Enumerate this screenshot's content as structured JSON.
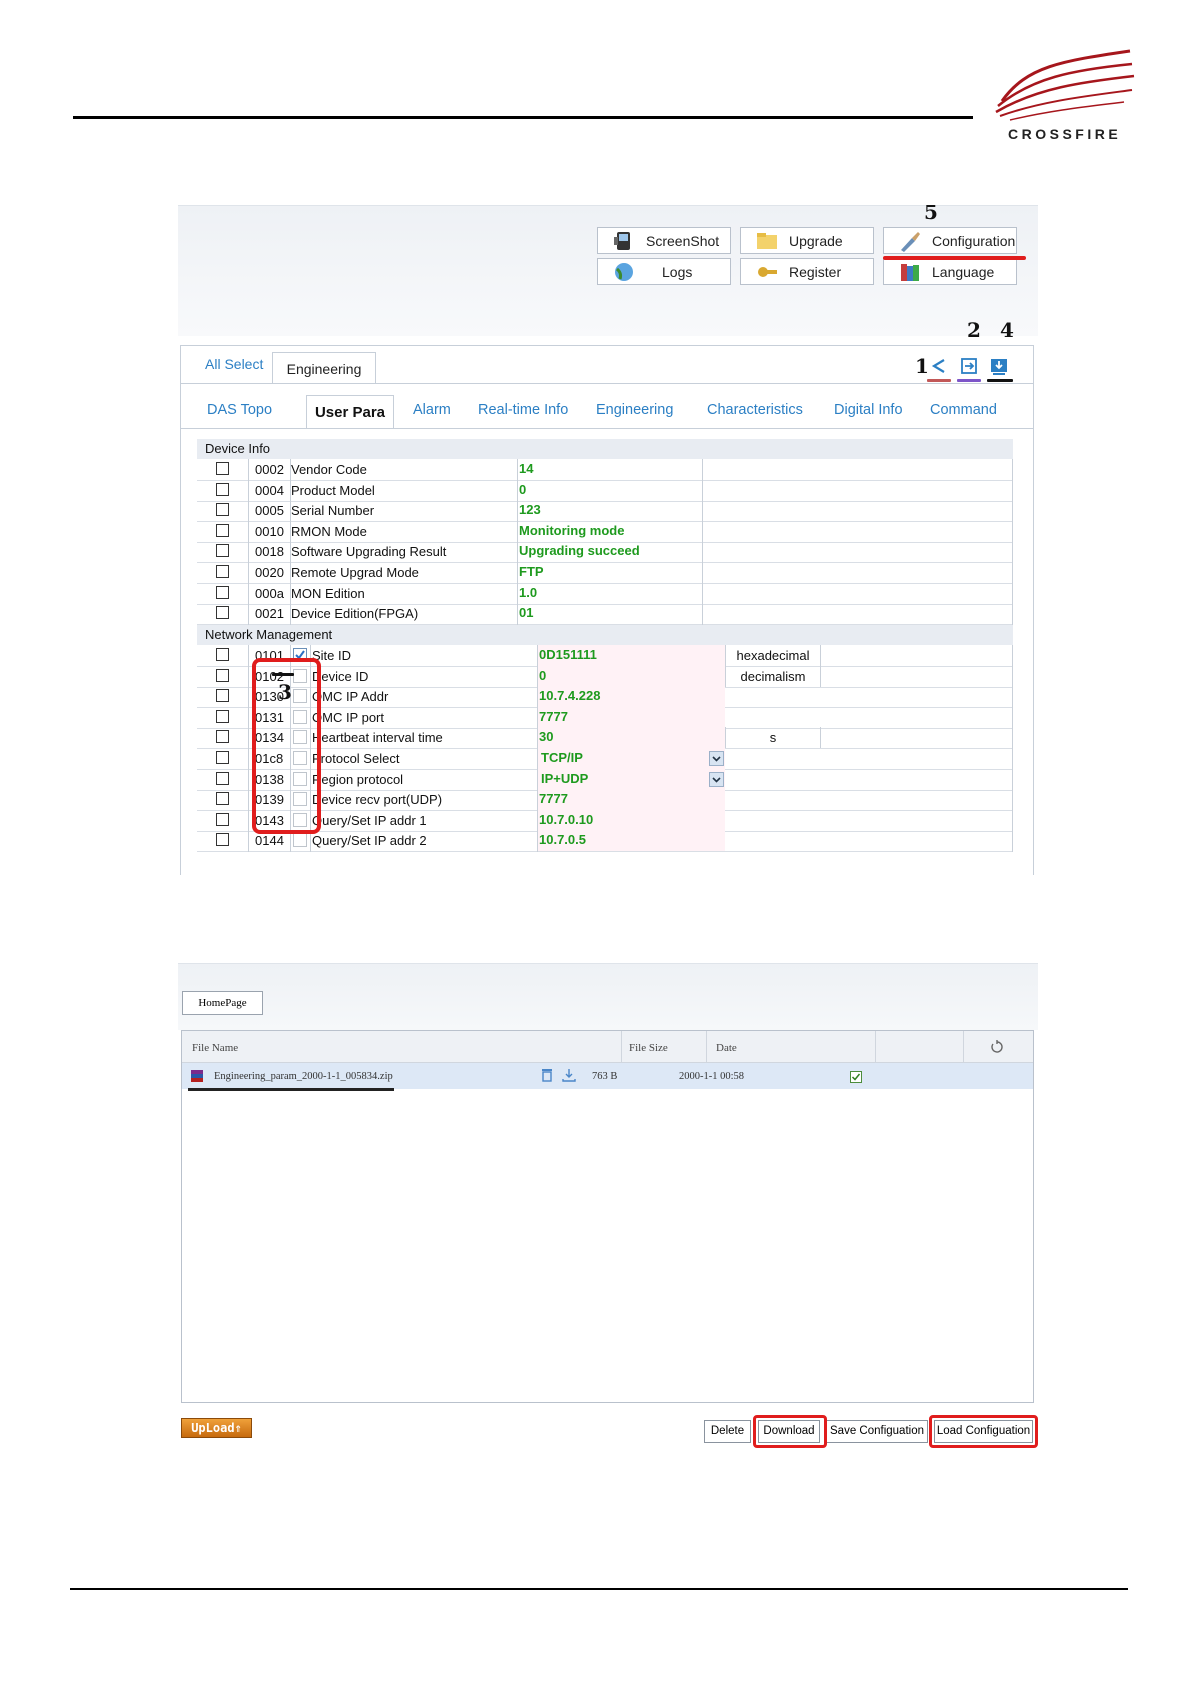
{
  "logo": {
    "brand": "CROSSFIRE"
  },
  "toolbar": {
    "buttons": [
      {
        "label": "ScreenShot"
      },
      {
        "label": "Upgrade"
      },
      {
        "label": "Configuration"
      },
      {
        "label": "Logs"
      },
      {
        "label": "Register"
      },
      {
        "label": "Language"
      }
    ]
  },
  "markers": {
    "m1": "1",
    "m2": "2",
    "m3": "3",
    "m4": "4",
    "m5": "5"
  },
  "tabs": {
    "all_select": "All Select",
    "engineering": "Engineering"
  },
  "subtabs": [
    "DAS Topo",
    "User Para",
    "Alarm",
    "Real-time Info",
    "Engineering",
    "Characteristics",
    "Digital Info",
    "Command"
  ],
  "sections": {
    "device_info": "Device Info",
    "network_management": "Network Management"
  },
  "device_rows": [
    {
      "code": "0002",
      "name": "Vendor Code",
      "value": "14"
    },
    {
      "code": "0004",
      "name": "Product Model",
      "value": "0"
    },
    {
      "code": "0005",
      "name": "Serial Number",
      "value": "123"
    },
    {
      "code": "0010",
      "name": "RMON Mode",
      "value": "Monitoring mode"
    },
    {
      "code": "0018",
      "name": "Software Upgrading Result",
      "value": "Upgrading succeed"
    },
    {
      "code": "0020",
      "name": "Remote Upgrad Mode",
      "value": "FTP"
    },
    {
      "code": "000a",
      "name": "MON Edition",
      "value": "1.0"
    },
    {
      "code": "0021",
      "name": "Device Edition(FPGA)",
      "value": "01"
    }
  ],
  "network_rows": [
    {
      "code": "0101",
      "name": "Site ID",
      "value": "0D151111",
      "unit": "hexadecimal",
      "checked": true
    },
    {
      "code": "0102",
      "name": "Device ID",
      "value": "0",
      "unit": "decimalism"
    },
    {
      "code": "0130",
      "name": "OMC IP Addr",
      "value": "10.7.4.228",
      "unit": ""
    },
    {
      "code": "0131",
      "name": "OMC IP port",
      "value": "7777",
      "unit": ""
    },
    {
      "code": "0134",
      "name": "Heartbeat interval time",
      "value": "30",
      "unit": "s"
    },
    {
      "code": "01c8",
      "name": "Protocol Select",
      "value": "TCP/IP",
      "unit": "",
      "dropdown": true
    },
    {
      "code": "0138",
      "name": "Region protocol",
      "value": "IP+UDP",
      "unit": "",
      "dropdown": true
    },
    {
      "code": "0139",
      "name": "Device recv port(UDP)",
      "value": "7777",
      "unit": ""
    },
    {
      "code": "0143",
      "name": "Query/Set IP addr 1",
      "value": "10.7.0.10",
      "unit": ""
    },
    {
      "code": "0144",
      "name": "Query/Set IP addr 2",
      "value": "10.7.0.5",
      "unit": ""
    }
  ],
  "file_manager": {
    "home_button": "HomePage",
    "columns": {
      "file_name": "File Name",
      "file_size": "File Size",
      "date": "Date"
    },
    "files": [
      {
        "name": "Engineering_param_2000-1-1_005834.zip",
        "size": "763 B",
        "date": "2000-1-1 00:58"
      }
    ],
    "buttons": {
      "upload": "UpLoad",
      "delete": "Delete",
      "download": "Download",
      "save": "Save Configuation",
      "load": "Load Configuation"
    }
  },
  "colors": {
    "accent_red": "#e01d1d",
    "link_blue": "#2b7fc4",
    "value_green": "#1e9a1e",
    "brand_red": "#a6161c"
  }
}
